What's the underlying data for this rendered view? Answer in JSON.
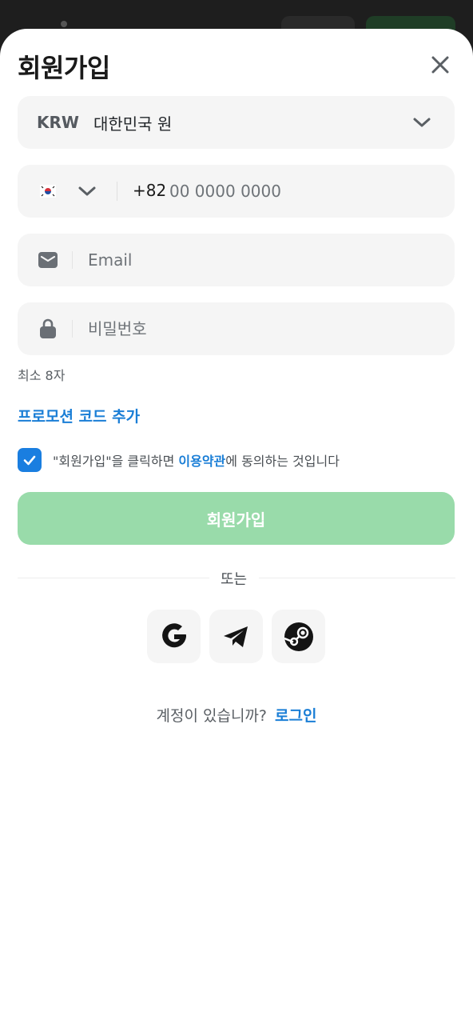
{
  "header": {
    "title": "회원가입"
  },
  "currency": {
    "code": "KRW",
    "name": "대한민국 원"
  },
  "phone": {
    "prefix": "+82",
    "placeholder": "00 0000 0000",
    "flag_icon": "south-korea-flag-icon"
  },
  "email": {
    "placeholder": "Email"
  },
  "password": {
    "placeholder": "비밀번호",
    "hint": "최소 8자"
  },
  "promo": {
    "label": "프로모션 코드 추가"
  },
  "agreement": {
    "prefix": "\"회원가입\"을 클릭하면 ",
    "link": "이용약관",
    "suffix": "에 동의하는 것입니다",
    "checked": true
  },
  "submit": {
    "label": "회원가입"
  },
  "divider": {
    "label": "또는"
  },
  "social": {
    "icons": [
      "google-icon",
      "telegram-icon",
      "steam-icon"
    ]
  },
  "footer": {
    "question": "계정이 있습니까?",
    "login_label": "로그인"
  },
  "colors": {
    "accent": "#1a7ed6",
    "submit_bg": "#99dbaa",
    "checkbox": "#1a7ee0"
  }
}
